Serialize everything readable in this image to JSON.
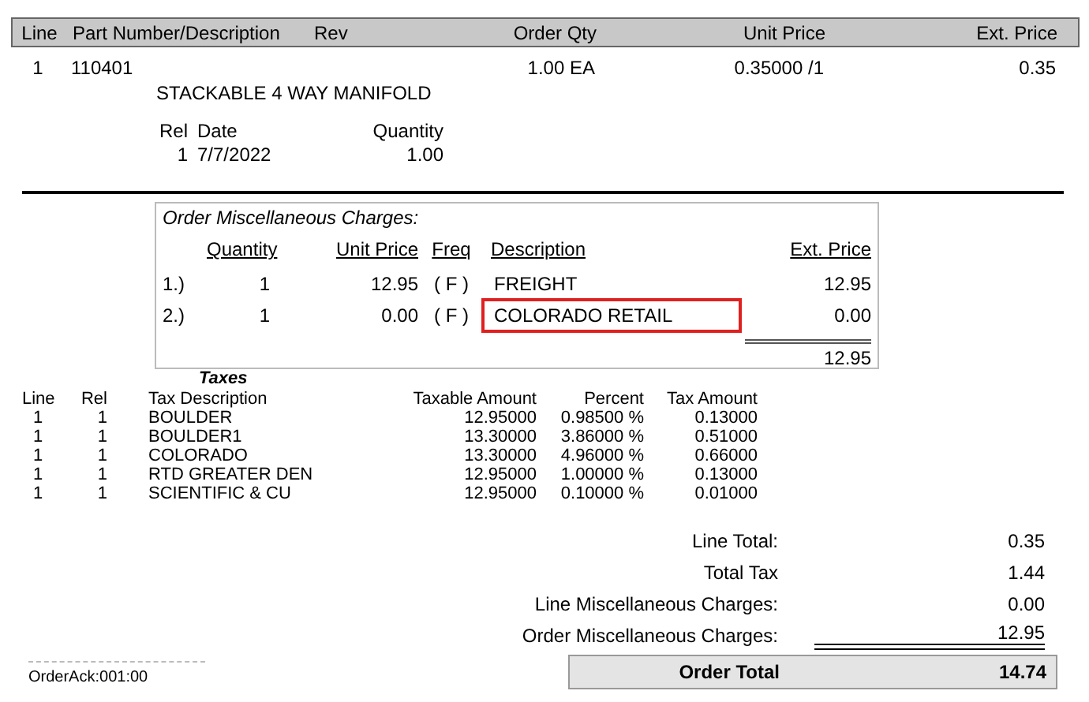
{
  "header": {
    "columns": [
      "Line",
      "Part Number/Description",
      "Rev",
      "Order Qty",
      "Unit Price",
      "Ext. Price"
    ]
  },
  "lines": [
    {
      "line": "1",
      "part_number": "110401",
      "order_qty": "1.00 EA",
      "unit_price": "0.35000 /1",
      "ext_price": "0.35",
      "description": "STACKABLE 4 WAY MANIFOLD",
      "releases": {
        "columns": [
          "Rel",
          "Date",
          "Quantity"
        ],
        "rows": [
          {
            "rel": "1",
            "date": "7/7/2022",
            "quantity": "1.00"
          }
        ]
      }
    }
  ],
  "misc_charges": {
    "title": "Order Miscellaneous Charges:",
    "columns": [
      "Quantity",
      "Unit Price",
      "Freq",
      "Description",
      "Ext. Price"
    ],
    "rows": [
      {
        "number": "1.)",
        "quantity": "1",
        "unit_price": "12.95",
        "freq": "( F )",
        "description": "FREIGHT",
        "ext_price": "12.95",
        "highlighted": false
      },
      {
        "number": "2.)",
        "quantity": "1",
        "unit_price": "0.00",
        "freq": "( F )",
        "description": "COLORADO RETAIL",
        "ext_price": "0.00",
        "highlighted": true
      }
    ],
    "total": "12.95"
  },
  "taxes": {
    "title": "Taxes",
    "columns": [
      "Line",
      "Rel",
      "Tax Description",
      "Taxable Amount",
      "Percent",
      "Tax Amount"
    ],
    "rows": [
      [
        "1",
        "1",
        "BOULDER",
        "12.95000",
        "0.98500 %",
        "0.13000"
      ],
      [
        "1",
        "1",
        "BOULDER1",
        "13.30000",
        "3.86000 %",
        "0.51000"
      ],
      [
        "1",
        "1",
        "COLORADO",
        "13.30000",
        "4.96000 %",
        "0.66000"
      ],
      [
        "1",
        "1",
        "RTD GREATER DEN",
        "12.95000",
        "1.00000 %",
        "0.13000"
      ],
      [
        "1",
        "1",
        "SCIENTIFIC & CU",
        "12.95000",
        "0.10000 %",
        "0.01000"
      ]
    ]
  },
  "totals": [
    {
      "label": "Line Total:",
      "value": "0.35"
    },
    {
      "label": "Total Tax",
      "value": "1.44"
    },
    {
      "label": "Line Miscellaneous Charges:",
      "value": "0.00"
    },
    {
      "label": "Order Miscellaneous Charges:",
      "value": "12.95"
    }
  ],
  "order_total": {
    "label": "Order Total",
    "value": "14.74"
  },
  "footer": {
    "form_id": "OrderAck:001:00"
  }
}
